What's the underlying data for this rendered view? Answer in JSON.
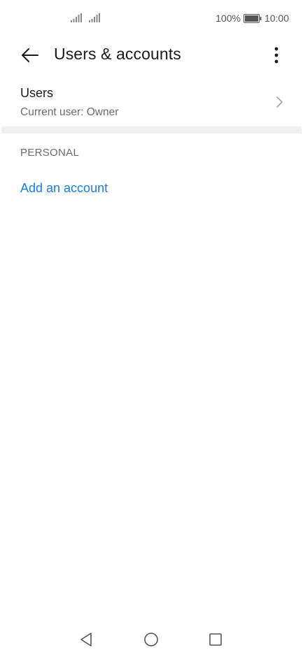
{
  "status_bar": {
    "battery_percent": "100%",
    "time": "10:00",
    "icons": [
      "signal-icon",
      "signal-icon",
      "battery-icon"
    ]
  },
  "header": {
    "title": "Users & accounts",
    "back_icon": "arrow-left-icon",
    "menu_icon": "more-vertical-icon"
  },
  "users": {
    "label": "Users",
    "subtitle": "Current user: Owner",
    "chevron_icon": "chevron-right-icon"
  },
  "personal": {
    "section_title": "PERSONAL",
    "add_account_label": "Add an account"
  },
  "nav_bar": {
    "icons": [
      "triangle-back-icon",
      "circle-home-icon",
      "square-recents-icon"
    ]
  },
  "colors": {
    "accent": "#1a7ee0",
    "text_primary": "#1a1a1a",
    "text_secondary": "#6b6b6b",
    "divider": "#f0f0f0"
  }
}
